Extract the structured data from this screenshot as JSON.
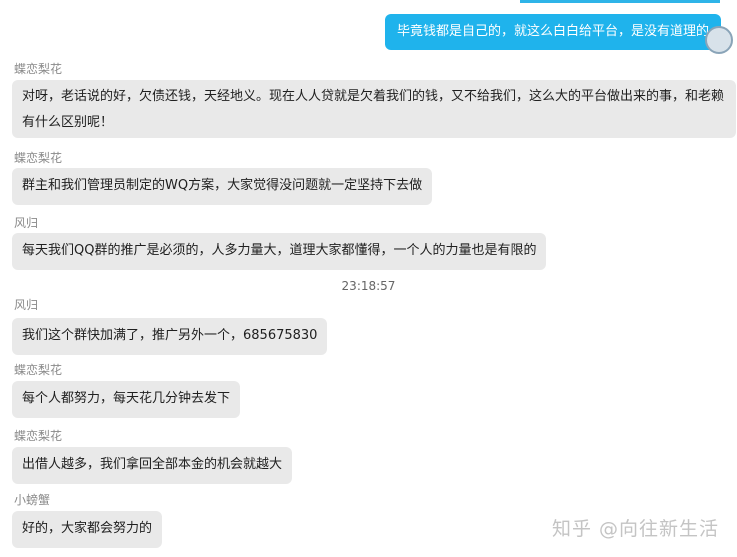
{
  "messages_sent": [
    {
      "text": "毕竟钱都是自己的，就这么白白给平台，是没有道理的"
    }
  ],
  "messages": [
    {
      "sender": "蝶恋梨花",
      "text": "对呀，老话说的好，欠债还钱，天经地义。现在人人贷就是欠着我们的钱，又不给我们，这么大的平台做出来的事，和老赖有什么区别呢！"
    },
    {
      "sender": "蝶恋梨花",
      "text": "群主和我们管理员制定的WQ方案，大家觉得没问题就一定坚持下去做"
    },
    {
      "sender": "风归",
      "text": "每天我们QQ群的推广是必须的，人多力量大，道理大家都懂得，一个人的力量也是有限的"
    },
    {
      "sender": "风归",
      "text": "我们这个群快加满了，推广另外一个，685675830"
    },
    {
      "sender": "蝶恋梨花",
      "text": "每个人都努力，每天花几分钟去发下"
    },
    {
      "sender": "蝶恋梨花",
      "text": "出借人越多，我们拿回全部本金的机会就越大"
    },
    {
      "sender": "小螃蟹",
      "text": "好的，大家都会努力的"
    }
  ],
  "timestamp": "23:18:57",
  "watermark": "知乎 @向往新生活"
}
